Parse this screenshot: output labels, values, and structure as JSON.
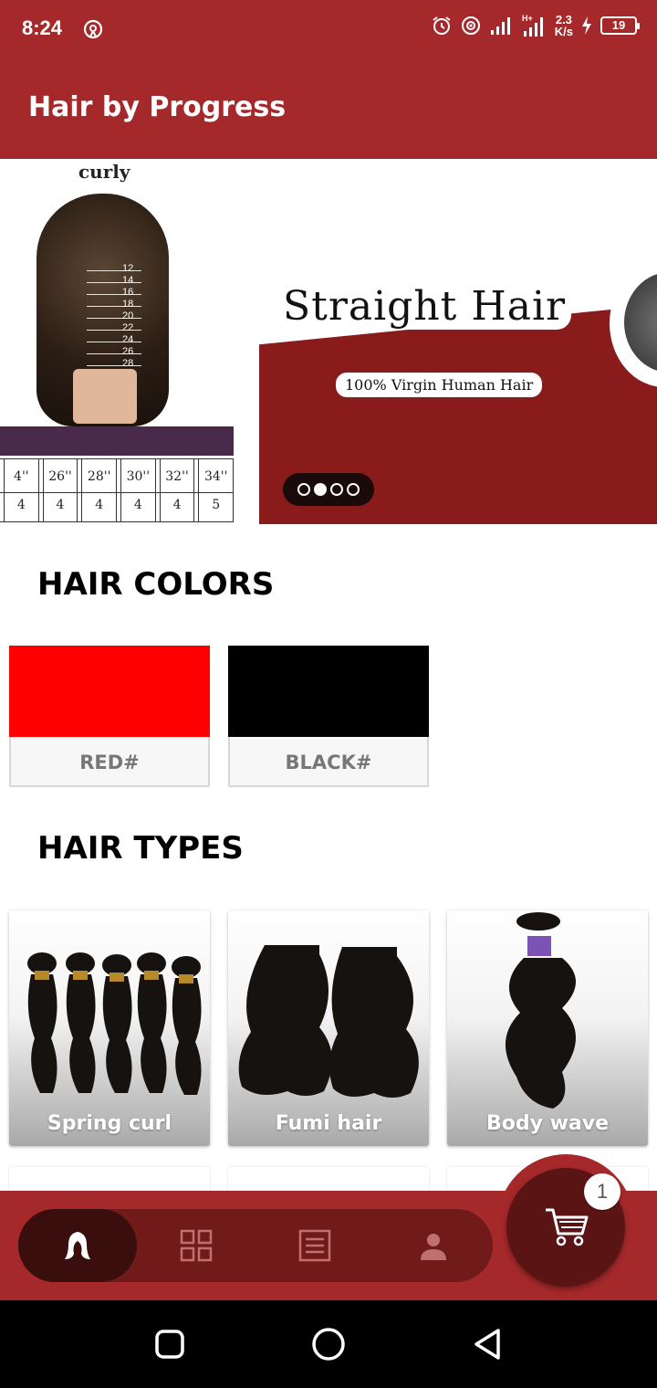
{
  "status_bar": {
    "time": "8:24",
    "network_speed_value": "2.3",
    "network_speed_unit": "K/s",
    "battery": "19",
    "icons": [
      "hotspot-icon",
      "alarm-icon",
      "hotspot-signal-icon",
      "signal-icon",
      "signal-hplus-icon",
      "charging-icon"
    ]
  },
  "app_bar": {
    "title": "Hair by Progress"
  },
  "banner": {
    "slide_left": {
      "title": "curly",
      "lengths": [
        "12",
        "14",
        "16",
        "18",
        "20",
        "22",
        "24",
        "26",
        "28"
      ],
      "table_header": [
        "4''",
        "26''",
        "28''",
        "30''",
        "32''",
        "34''"
      ],
      "table_values": [
        "4",
        "4",
        "4",
        "4",
        "4",
        "5"
      ]
    },
    "slide_right": {
      "title": "Straight Hair",
      "subtitle": "100% Virgin Human Hair"
    },
    "indicator": {
      "count": 4,
      "active_index": 1
    }
  },
  "sections": {
    "colors_heading": "HAIR COLORS",
    "types_heading": "HAIR TYPES"
  },
  "hair_colors": [
    {
      "label": "RED#",
      "swatch": "#ff0000"
    },
    {
      "label": "BLACK#",
      "swatch": "#000000"
    }
  ],
  "hair_types": [
    {
      "label": "Spring curl"
    },
    {
      "label": "Fumi hair"
    },
    {
      "label": "Body wave"
    }
  ],
  "bottom_nav": {
    "items": [
      "hair-icon",
      "grid-icon",
      "list-icon",
      "profile-icon"
    ],
    "active_index": 0,
    "cart_count": "1"
  },
  "colors": {
    "brand": "#a5282b",
    "nav_pill": "#701a1a",
    "nav_active": "#3b0e0e"
  }
}
